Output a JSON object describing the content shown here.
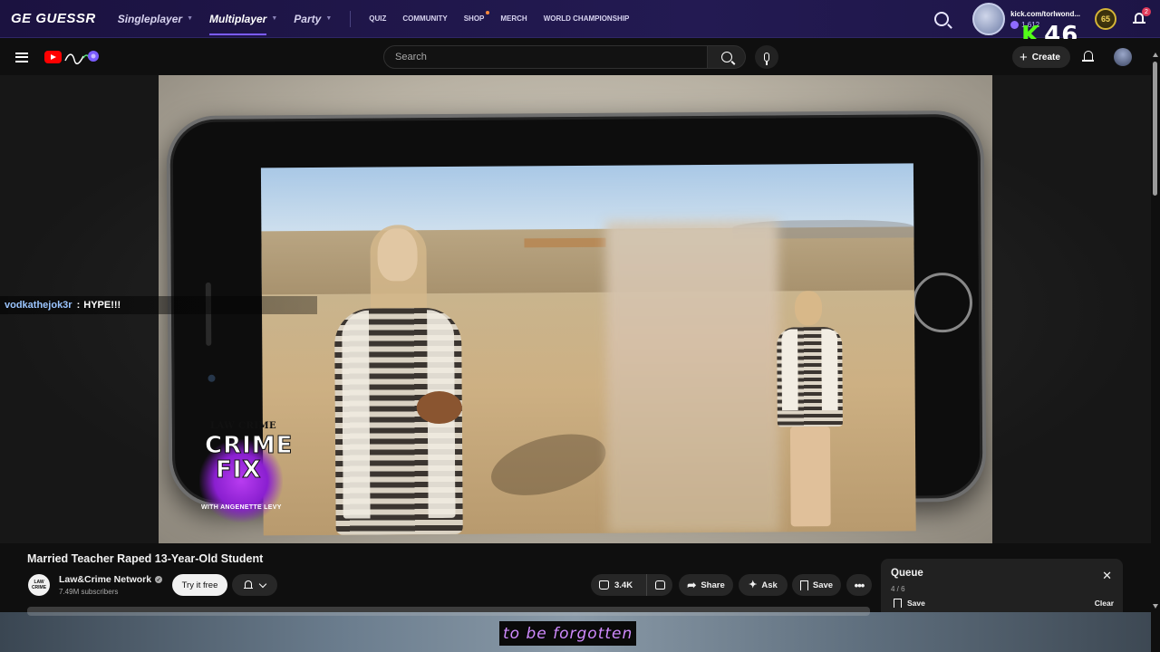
{
  "geoguessr": {
    "logo_text": "GE GUESSR",
    "nav": {
      "singleplayer": "Singleplayer",
      "multiplayer": "Multiplayer",
      "party": "Party",
      "quiz": "QUIZ",
      "community": "COMMUNITY",
      "shop": "SHOP",
      "merch": "MERCH",
      "world_championship": "WORLD CHAMPIONSHIP"
    },
    "user": {
      "name": "kick.com/torlwond...",
      "coins": "1,612",
      "level": "65"
    },
    "notification_count": "2",
    "accent_color": "#7c5cff"
  },
  "kick_overlay": {
    "k": "K",
    "number": "46",
    "color": "#53fc18"
  },
  "youtube": {
    "search_placeholder": "Search",
    "create_label": "Create"
  },
  "chat": {
    "user": "vodkathejok3r",
    "separator": ":",
    "message": "HYPE!!!"
  },
  "video_branding": {
    "top": "LAW  CRIME",
    "crime": "CRIME",
    "fix": "FIX",
    "with_line": "WITH ANGENETTE LEVY"
  },
  "video": {
    "title": "Married Teacher Raped 13-Year-Old Student",
    "channel_name": "Law&Crime Network",
    "channel_avatar_text": "LAW CRIME",
    "subscribers": "7.49M subscribers",
    "try_label": "Try it free",
    "likes": "3.4K",
    "share_label": "Share",
    "ask_label": "Ask",
    "save_label": "Save"
  },
  "queue": {
    "title": "Queue",
    "count": "4 / 6",
    "save_label": "Save",
    "clear_label": "Clear"
  },
  "caption": {
    "text": "to be forgotten",
    "color": "#d08bff"
  }
}
